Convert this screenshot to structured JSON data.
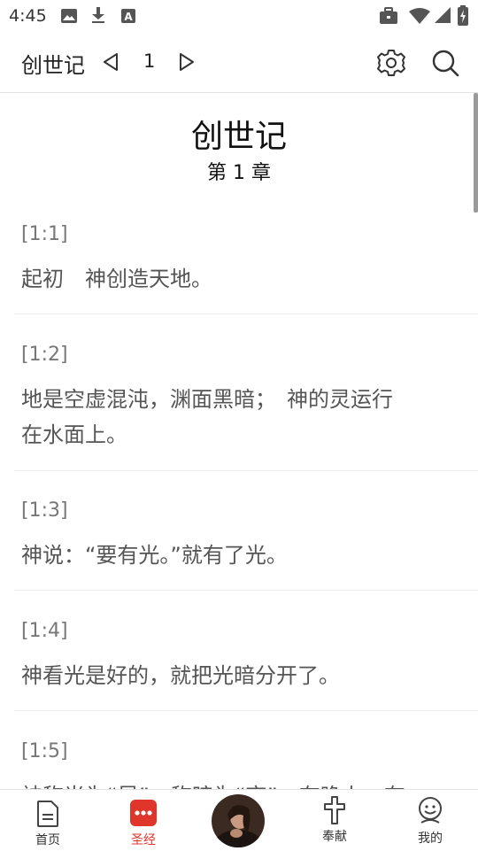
{
  "status_bar": {
    "time": "4:45",
    "icons": [
      "image-icon",
      "download-icon",
      "font-icon",
      "briefcase-icon",
      "wifi-icon",
      "signal-icon",
      "battery-icon"
    ]
  },
  "header": {
    "book": "创世记",
    "chapter": "1",
    "icons": [
      "prev-chapter-icon",
      "next-chapter-icon",
      "settings-icon",
      "search-icon"
    ]
  },
  "reader": {
    "title": "创世记",
    "subtitle": "第 1 章",
    "verses": [
      {
        "ref": "[1:1]",
        "lines": [
          "起初　神创造天地。"
        ]
      },
      {
        "ref": "[1:2]",
        "lines": [
          "地是空虚混沌，渊面黑暗；　神的灵运行",
          "在水面上。"
        ]
      },
      {
        "ref": "[1:3]",
        "lines": [
          "神说：“要有光。”就有了光。"
        ]
      },
      {
        "ref": "[1:4]",
        "lines": [
          "神看光是好的，就把光暗分开了。"
        ]
      },
      {
        "ref": "[1:5]",
        "lines": [
          "神称光为“昼”，称暗为“夜”。有晚上，有"
        ]
      }
    ]
  },
  "tabbar": {
    "tabs": [
      {
        "label": "首页",
        "icon": "document-icon",
        "active": false
      },
      {
        "label": "圣经",
        "icon": "bible-dots-icon",
        "active": true
      },
      {
        "label": "",
        "icon": "prayer-avatar",
        "active": false
      },
      {
        "label": "奉献",
        "icon": "cross-icon",
        "active": false
      },
      {
        "label": "我的",
        "icon": "user-face-icon",
        "active": false
      }
    ],
    "active_color": "#e0352b"
  }
}
